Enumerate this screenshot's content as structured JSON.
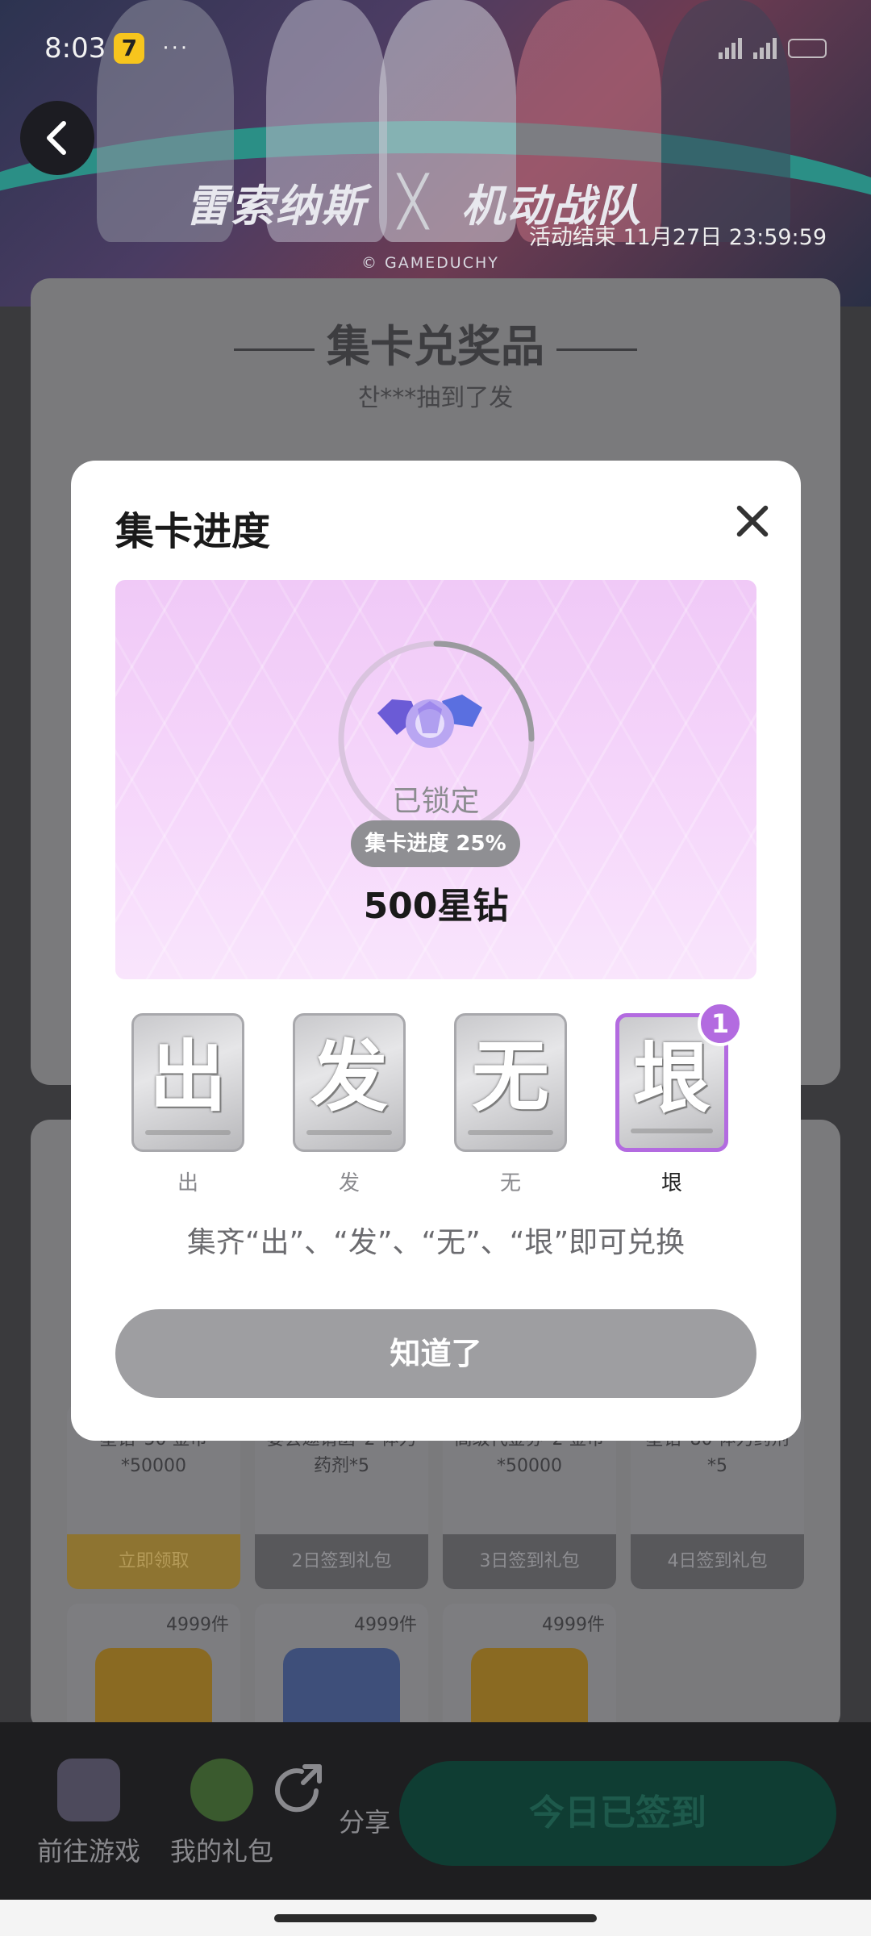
{
  "status_bar": {
    "time": "8:03",
    "app_badge": "7",
    "dots": "···"
  },
  "banner": {
    "title_left": "雷索纳斯",
    "title_x": "╳",
    "title_right": "机动战队",
    "credit": "© GAMEDUCHY",
    "end_time": "活动结束 11月27日 23:59:59"
  },
  "back_icon": "chevron-left-icon",
  "card_panel": {
    "title": "集卡兑奖品",
    "subtitle": "찬***抽到了发"
  },
  "gifts": [
    {
      "desc": "星钻*50 金币*50000",
      "button": "立即领取"
    },
    {
      "desc": "宴会邀请函*2 体力药剂*5",
      "button": "2日签到礼包"
    },
    {
      "desc": "高级代金券*2 金币*50000",
      "button": "3日签到礼包"
    },
    {
      "desc": "星钻*80 体力药剂*5",
      "button": "4日签到礼包"
    }
  ],
  "stock_items": [
    {
      "count": "4999件"
    },
    {
      "count": "4999件"
    },
    {
      "count": "4999件"
    }
  ],
  "bottom_nav": {
    "go_game": "前往游戏",
    "my_gifts": "我的礼包",
    "share": "分享",
    "checkin": "今日已签到"
  },
  "modal": {
    "title": "集卡进度",
    "locked_text": "已锁定",
    "progress_label": "集卡进度 25%",
    "progress_fraction": 0.25,
    "prize_name": "500星钻",
    "cards": [
      {
        "char": "出",
        "label": "出",
        "owned": false
      },
      {
        "char": "发",
        "label": "发",
        "owned": false
      },
      {
        "char": "无",
        "label": "无",
        "owned": false
      },
      {
        "char": "垠",
        "label": "垠",
        "owned": true,
        "count": "1"
      }
    ],
    "hint": "集齐“出”、“发”、“无”、“垠”即可兑换",
    "ok_button": "知道了"
  },
  "colors": {
    "accent_purple": "#b36be0",
    "prize_bg": "#f0c9f7",
    "button_gray": "#9e9ea1",
    "checkin_green": "#0f3d33"
  }
}
